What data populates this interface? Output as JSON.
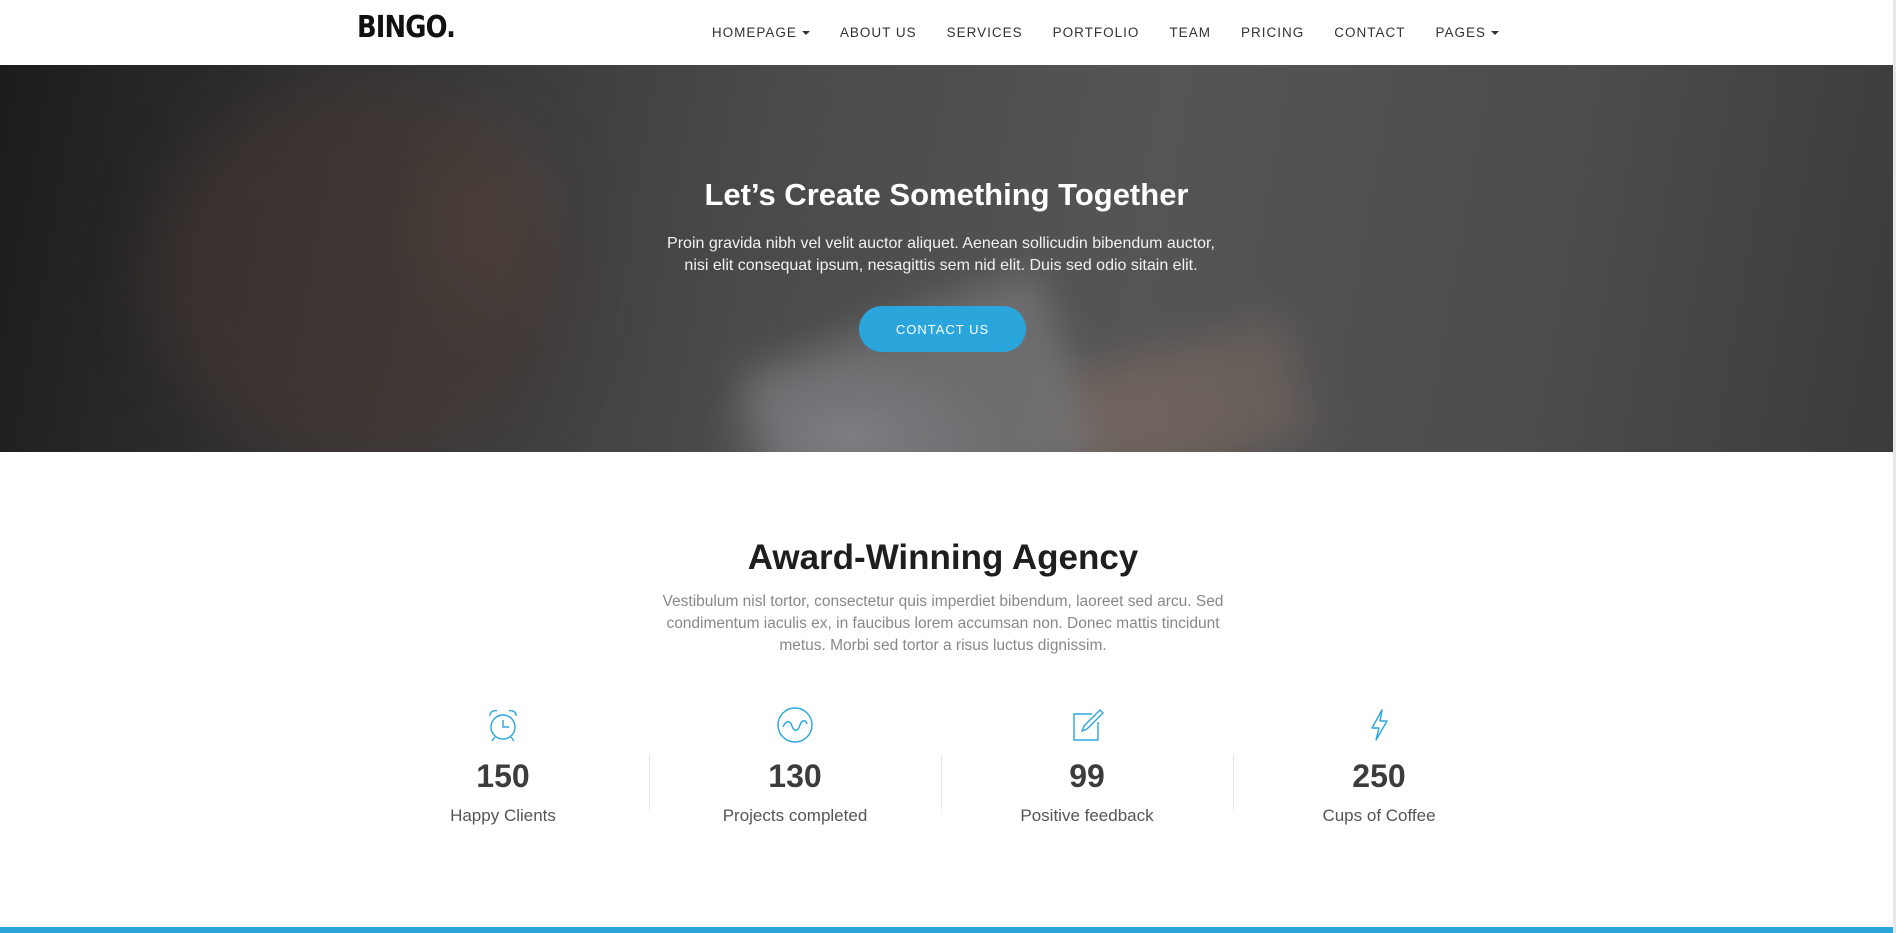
{
  "brand": {
    "logo": "BINGO."
  },
  "nav": {
    "items": [
      {
        "label": "HOMEPAGE",
        "dropdown": true
      },
      {
        "label": "ABOUT US",
        "dropdown": false
      },
      {
        "label": "SERVICES",
        "dropdown": false
      },
      {
        "label": "PORTFOLIO",
        "dropdown": false
      },
      {
        "label": "TEAM",
        "dropdown": false
      },
      {
        "label": "PRICING",
        "dropdown": false
      },
      {
        "label": "CONTACT",
        "dropdown": false
      },
      {
        "label": "PAGES",
        "dropdown": true
      }
    ]
  },
  "hero": {
    "title": "Let’s Create Something Together",
    "text": "Proin gravida nibh vel velit auctor aliquet. Aenean sollicudin bibendum auctor, nisi elit consequat ipsum, nesagittis sem nid elit. Duis sed odio sitain elit.",
    "button": "CONTACT US"
  },
  "about": {
    "title": "Award-Winning Agency",
    "text": "Vestibulum nisl tortor, consectetur quis imperdiet bibendum, laoreet sed arcu. Sed condimentum iaculis ex, in faucibus lorem accumsan non. Donec mattis tincidunt metus. Morbi sed tortor a risus luctus dignissim.",
    "stats": [
      {
        "icon": "alarm-clock-icon",
        "number": "150",
        "label": "Happy Clients"
      },
      {
        "icon": "wave-circle-icon",
        "number": "130",
        "label": "Projects completed"
      },
      {
        "icon": "edit-note-icon",
        "number": "99",
        "label": "Positive feedback"
      },
      {
        "icon": "lightning-icon",
        "number": "250",
        "label": "Cups of Coffee"
      }
    ]
  },
  "colors": {
    "accent": "#2aa6dc",
    "text_dark": "#1e1e1e",
    "text_muted": "#888888"
  }
}
